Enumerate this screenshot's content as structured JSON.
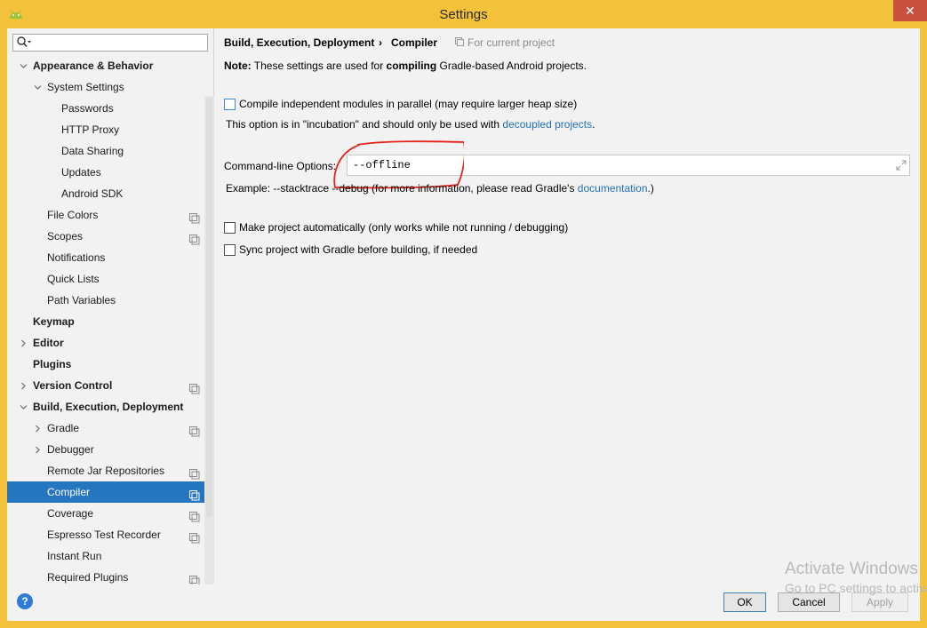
{
  "window": {
    "title": "Settings",
    "close_glyph": "✕"
  },
  "search": {
    "placeholder": ""
  },
  "sidebar": {
    "items": [
      {
        "label": "Appearance & Behavior",
        "arrow": "expanded",
        "bold": true,
        "badge": false,
        "selected": false
      },
      {
        "label": "System Settings",
        "arrow": "expanded",
        "bold": false,
        "badge": false,
        "selected": false
      },
      {
        "label": "Passwords",
        "arrow": "",
        "bold": false,
        "badge": false,
        "selected": false
      },
      {
        "label": "HTTP Proxy",
        "arrow": "",
        "bold": false,
        "badge": false,
        "selected": false
      },
      {
        "label": "Data Sharing",
        "arrow": "",
        "bold": false,
        "badge": false,
        "selected": false
      },
      {
        "label": "Updates",
        "arrow": "",
        "bold": false,
        "badge": false,
        "selected": false
      },
      {
        "label": "Android SDK",
        "arrow": "",
        "bold": false,
        "badge": false,
        "selected": false
      },
      {
        "label": "File Colors",
        "arrow": "",
        "bold": false,
        "badge": true,
        "selected": false
      },
      {
        "label": "Scopes",
        "arrow": "",
        "bold": false,
        "badge": true,
        "selected": false
      },
      {
        "label": "Notifications",
        "arrow": "",
        "bold": false,
        "badge": false,
        "selected": false
      },
      {
        "label": "Quick Lists",
        "arrow": "",
        "bold": false,
        "badge": false,
        "selected": false
      },
      {
        "label": "Path Variables",
        "arrow": "",
        "bold": false,
        "badge": false,
        "selected": false
      },
      {
        "label": "Keymap",
        "arrow": "",
        "bold": true,
        "badge": false,
        "selected": false
      },
      {
        "label": "Editor",
        "arrow": "collapsed",
        "bold": true,
        "badge": false,
        "selected": false
      },
      {
        "label": "Plugins",
        "arrow": "",
        "bold": true,
        "badge": false,
        "selected": false
      },
      {
        "label": "Version Control",
        "arrow": "collapsed",
        "bold": true,
        "badge": true,
        "selected": false
      },
      {
        "label": "Build, Execution, Deployment",
        "arrow": "expanded",
        "bold": true,
        "badge": false,
        "selected": false
      },
      {
        "label": "Gradle",
        "arrow": "collapsed",
        "bold": false,
        "badge": true,
        "selected": false
      },
      {
        "label": "Debugger",
        "arrow": "collapsed",
        "bold": false,
        "badge": false,
        "selected": false
      },
      {
        "label": "Remote Jar Repositories",
        "arrow": "",
        "bold": false,
        "badge": true,
        "selected": false
      },
      {
        "label": "Compiler",
        "arrow": "",
        "bold": false,
        "badge": true,
        "selected": true
      },
      {
        "label": "Coverage",
        "arrow": "",
        "bold": false,
        "badge": true,
        "selected": false
      },
      {
        "label": "Espresso Test Recorder",
        "arrow": "",
        "bold": false,
        "badge": true,
        "selected": false
      },
      {
        "label": "Instant Run",
        "arrow": "",
        "bold": false,
        "badge": false,
        "selected": false
      },
      {
        "label": "Required Plugins",
        "arrow": "",
        "bold": false,
        "badge": true,
        "selected": false
      }
    ]
  },
  "content": {
    "breadcrumb_parent": "Build, Execution, Deployment",
    "breadcrumb_sep": "›",
    "breadcrumb_current": "Compiler",
    "for_current_project": "For current project",
    "note_prefix": "Note:",
    "note_middle": " These settings are used for ",
    "note_bold": "compiling",
    "note_suffix": " Gradle-based Android projects.",
    "parallel_label": "Compile independent modules in parallel (may require larger heap size)",
    "parallel_checked": false,
    "incubation_text": "This option is in \"incubation\" and should only be used with ",
    "incubation_link": "decoupled projects",
    "incubation_end": ".",
    "cmd_label": "Command-line Options:",
    "cmd_value": "--offline",
    "example_text": "Example: --stacktrace --debug (for more information, please read Gradle's ",
    "example_link": "documentation",
    "example_end": ".)",
    "make_auto_label": "Make project automatically (only works while not running / debugging)",
    "make_auto_checked": false,
    "sync_label": "Sync project with Gradle before building, if needed",
    "sync_checked": false
  },
  "buttons": {
    "help": "?",
    "ok": "OK",
    "cancel": "Cancel",
    "apply": "Apply"
  },
  "watermark": {
    "line1": "Activate Windows",
    "line2": "Go to PC settings to activate Windows."
  },
  "colors": {
    "accent": "#2675bf",
    "link": "#2470b3",
    "frame": "#f3c13a",
    "annotation": "#e8231c"
  }
}
